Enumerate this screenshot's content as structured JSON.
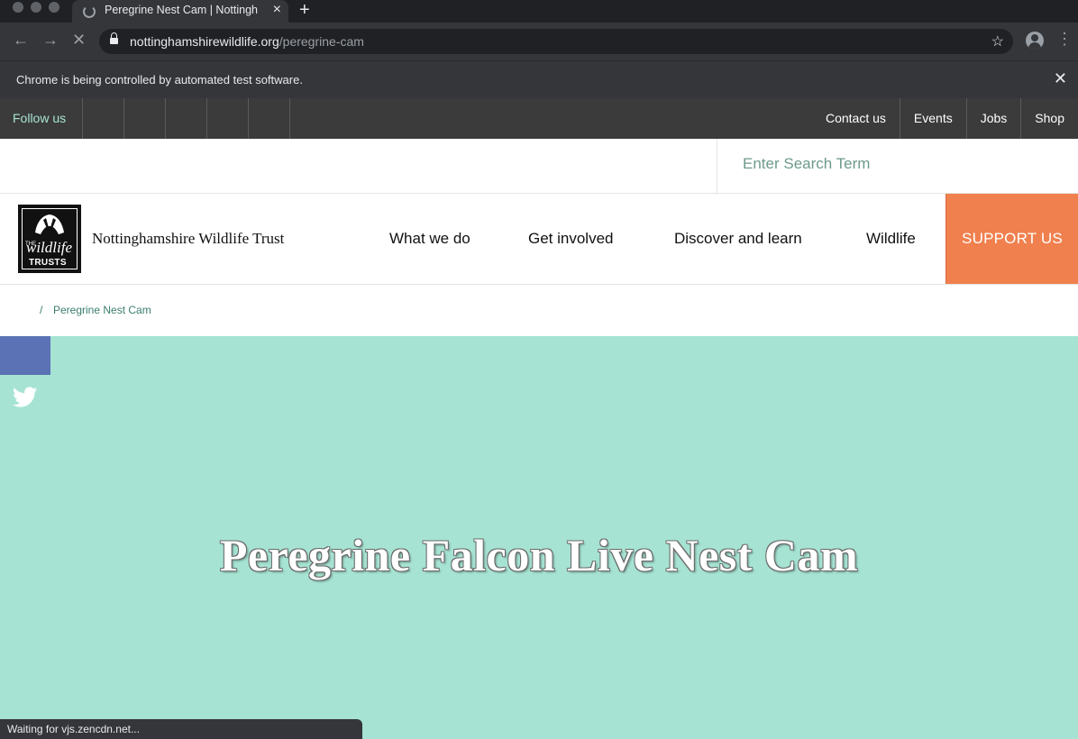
{
  "browser": {
    "tab": {
      "title": "Peregrine Nest Cam | Nottingh",
      "loading": true
    },
    "address": {
      "domain": "nottinghamshirewildlife.org",
      "path": "/peregrine-cam"
    },
    "infobar": {
      "message": "Chrome is being controlled by automated test software."
    },
    "status": {
      "text": "Waiting for vjs.zencdn.net..."
    },
    "icons": [
      "back-icon",
      "forward-icon",
      "stop-icon",
      "lock-icon",
      "star-icon",
      "profile-icon",
      "menu-icon",
      "close-icon",
      "new-tab-icon"
    ]
  },
  "site": {
    "topbar": {
      "follow_label": "Follow us",
      "links": [
        "Contact us",
        "Events",
        "Jobs",
        "Shop"
      ]
    },
    "search": {
      "placeholder": "Enter Search Term"
    },
    "logo": {
      "line1": "THE",
      "line2": "wildlife",
      "line3": "TRUSTS"
    },
    "org_name": "Nottinghamshire Wildlife Trust",
    "nav": {
      "items": [
        "What we do",
        "Get involved",
        "Discover and learn",
        "Wildlife"
      ],
      "cta": "SUPPORT US"
    },
    "breadcrumb": {
      "separator": "/",
      "current": "Peregrine Nest Cam"
    },
    "hero": {
      "title": "Peregrine Falcon Live Nest Cam"
    },
    "colors": {
      "hero_bg": "#a6e3d3",
      "cta_bg": "#f0804e",
      "topbar_bg": "#3b3b3b",
      "facebook": "#5b72b5",
      "accent_text": "#3b7d6e"
    }
  }
}
